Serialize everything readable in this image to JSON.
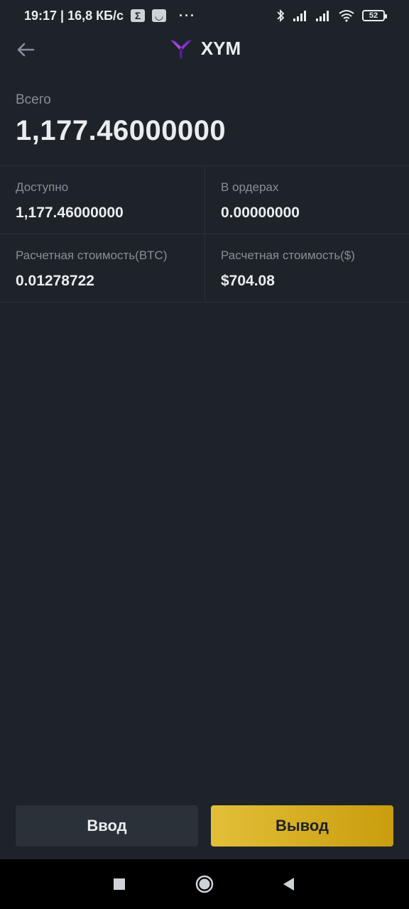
{
  "status_bar": {
    "time_speed": "19:17 | 16,8 КБ/с",
    "icon_sigma": "Σ",
    "icon_smile": "◡",
    "more": "···",
    "battery": "52"
  },
  "header": {
    "coin": "XYM",
    "logo_colors": [
      "#7b2fd0",
      "#b04ee0",
      "#5a1aa8"
    ]
  },
  "total": {
    "label": "Всего",
    "value": "1,177.46000000"
  },
  "details": [
    {
      "label": "Доступно",
      "value": "1,177.46000000"
    },
    {
      "label": "В ордерах",
      "value": "0.00000000"
    },
    {
      "label": "Расчетная стоимость(BTC)",
      "value": "0.01278722"
    },
    {
      "label": "Расчетная стоимость($)",
      "value": "$704.08"
    }
  ],
  "actions": {
    "deposit": "Ввод",
    "withdraw": "Вывод"
  },
  "colors": {
    "background": "#1e2329",
    "accent": "#f0b90b",
    "muted_text": "#848e9c"
  }
}
